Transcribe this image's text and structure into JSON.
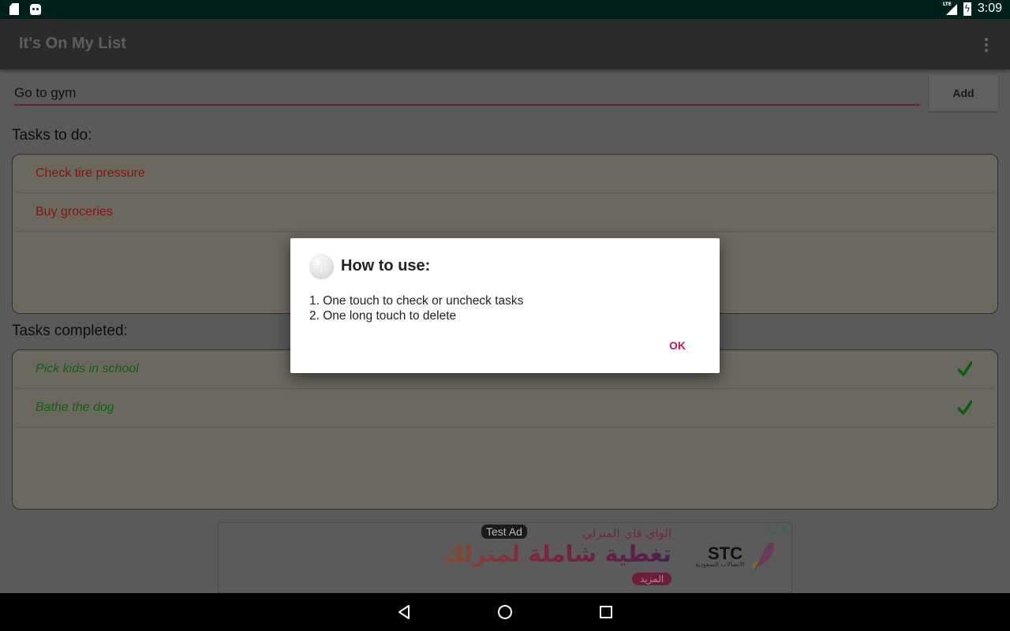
{
  "status_bar": {
    "left_icons": [
      "sd-card-icon",
      "android-debug-icon"
    ],
    "network": "LTE",
    "time": "3:09"
  },
  "app_bar": {
    "title": "It's On My List",
    "overflow_icon": "more-vert-icon"
  },
  "input": {
    "value": "Go to gym",
    "add_label": "Add",
    "underline_color": "#6f1f36"
  },
  "todo": {
    "label": "Tasks to do:",
    "items": [
      {
        "text": "Check tire pressure"
      },
      {
        "text": "Buy groceries"
      }
    ],
    "text_color": "#8a1010"
  },
  "completed": {
    "label": "Tasks completed:",
    "items": [
      {
        "text": "Pick kids in school",
        "checked": true
      },
      {
        "text": "Bathe the dog",
        "checked": true
      }
    ],
    "text_color": "#0f6114"
  },
  "ad": {
    "badge": "Test Ad",
    "subtitle": "الواي فاي المنزلي",
    "headline": "تغطية شاملة لمنزلك",
    "cta": "المزيد",
    "brand": "STC",
    "brand_sub": "الاتصالات السعودية"
  },
  "dialog": {
    "title": "How to use:",
    "lines": [
      "1. One touch to check or uncheck tasks",
      "2. One long touch to delete"
    ],
    "ok_label": "OK",
    "accent": "#c2185b"
  },
  "nav_bar": {
    "buttons": [
      "back",
      "home",
      "recents"
    ]
  }
}
